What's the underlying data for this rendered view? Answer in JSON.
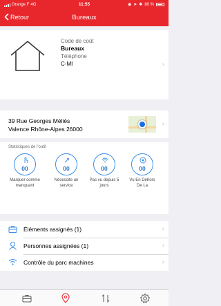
{
  "status_bar": {
    "carrier": "Orange F",
    "network": "4G",
    "time": "11:55",
    "battery": "80 %"
  },
  "nav": {
    "back_label": "Retour",
    "title": "Bureaux"
  },
  "header": {
    "cost_code_label": "Code de coût",
    "name": "Bureaux",
    "phone_label": "Téléphone",
    "code": "C-MI"
  },
  "address": {
    "line1": "39 Rue Georges Méliès",
    "line2": "Valence Rhône-Alpes 26000"
  },
  "stats": {
    "title": "Statistiques de l'outil",
    "items": [
      {
        "value": "00",
        "caption": "Marquer comme manquant",
        "icon": "hand-pointer-icon"
      },
      {
        "value": "00",
        "caption": "Nécessite un service",
        "icon": "wrench-icon"
      },
      {
        "value": "00",
        "caption": "Pas vu depuis 5 jours",
        "icon": "wifi-icon"
      },
      {
        "value": "00",
        "caption": "Vu En Dehors De La",
        "icon": "target-icon"
      }
    ]
  },
  "list": [
    {
      "label": "Éléments assignés (1)",
      "icon": "briefcase-icon"
    },
    {
      "label": "Personnes assignées (1)",
      "icon": "person-icon"
    },
    {
      "label": "Contrôle du parc machines",
      "icon": "wifi-icon"
    }
  ],
  "tabbar": {
    "items": [
      "briefcase-icon",
      "map-pin-icon",
      "transfer-icon",
      "settings-icon"
    ]
  },
  "colors": {
    "accent": "#e8272d",
    "link": "#3a8ee6"
  }
}
